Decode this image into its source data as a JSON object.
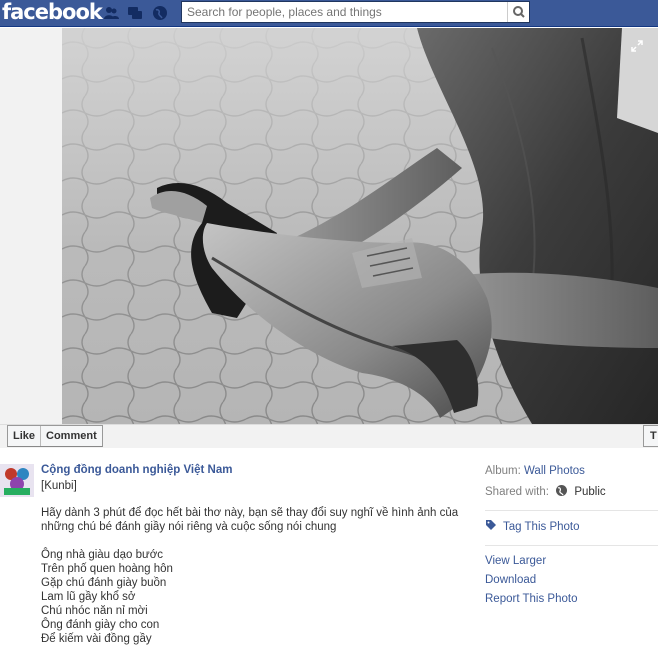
{
  "header": {
    "logo": "facebook",
    "search": {
      "placeholder": "Search for people, places and things"
    },
    "colors": {
      "brand": "#3b5998",
      "link": "#3b5998"
    }
  },
  "actions": {
    "like": "Like",
    "comment": "Comment",
    "overflow": "T"
  },
  "post": {
    "page_name": "Cộng đồng doanh nghiệp Việt Nam",
    "tagline": "[Kunbi]",
    "description": "Hãy dành 3 phút để đọc hết bài thơ này, bạn sẽ thay đổi suy nghĩ về hình ảnh của những chú bé đánh giầy nói riêng và cuộc sống nói chung",
    "poem_lines": [
      "Ông nhà giàu dạo bước",
      "Trên phố quen hoàng hôn",
      "Gặp chú đánh giày buồn",
      "Lam lũ gầy khổ sở",
      "Chú nhóc năn nỉ mời",
      "Ông đánh giày cho con",
      "Để kiếm vài đồng gầy"
    ]
  },
  "sidebar": {
    "album_label": "Album:",
    "album_value": "Wall Photos",
    "shared_label": "Shared with:",
    "shared_value": "Public",
    "tag_photo": "Tag This Photo",
    "view_larger": "View Larger",
    "download": "Download",
    "report": "Report This Photo"
  }
}
